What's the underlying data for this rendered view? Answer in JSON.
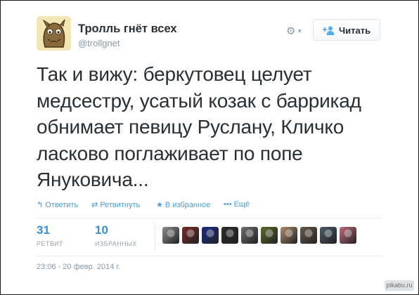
{
  "profile": {
    "name": "Тролль гнёт всех",
    "handle": "@trollgnet",
    "avatar_icon": "troll-avatar"
  },
  "controls": {
    "settings_icon": "gear-icon",
    "follow_label": "Читать"
  },
  "tweet": {
    "text": "Так и вижу: беркутовец целует медсестру, усатый козак с баррикад обнимает певицу Руслану, Кличко ласково поглаживает по попе Януковича..."
  },
  "actions": [
    {
      "icon": "↰",
      "label": "Ответить"
    },
    {
      "icon": "⇄",
      "label": "Ретвитнуть"
    },
    {
      "icon": "★",
      "label": "В избранное"
    },
    {
      "icon": "•••",
      "label": "Ещё"
    }
  ],
  "stats": {
    "retweets": {
      "count": "31",
      "label": "РЕТВИТ"
    },
    "favorites": {
      "count": "10",
      "label": "ИЗБРАННЫХ"
    }
  },
  "favoriters_colors": [
    "#8d8d8d",
    "#7a2a2a",
    "#1b2a8a",
    "#2a2a2a",
    "#6e6e6e",
    "#5a6a2a",
    "#b08a6a",
    "#6a5a4a",
    "#4a5a6a",
    "#c06a7a"
  ],
  "timestamp": "23:06 - 20 февр. 2014 г.",
  "watermark": "pikabu.ru",
  "colors": {
    "link": "#4f9cd3",
    "stat": "#3a8fd0",
    "text": "#292f33",
    "muted": "#8899a6"
  }
}
